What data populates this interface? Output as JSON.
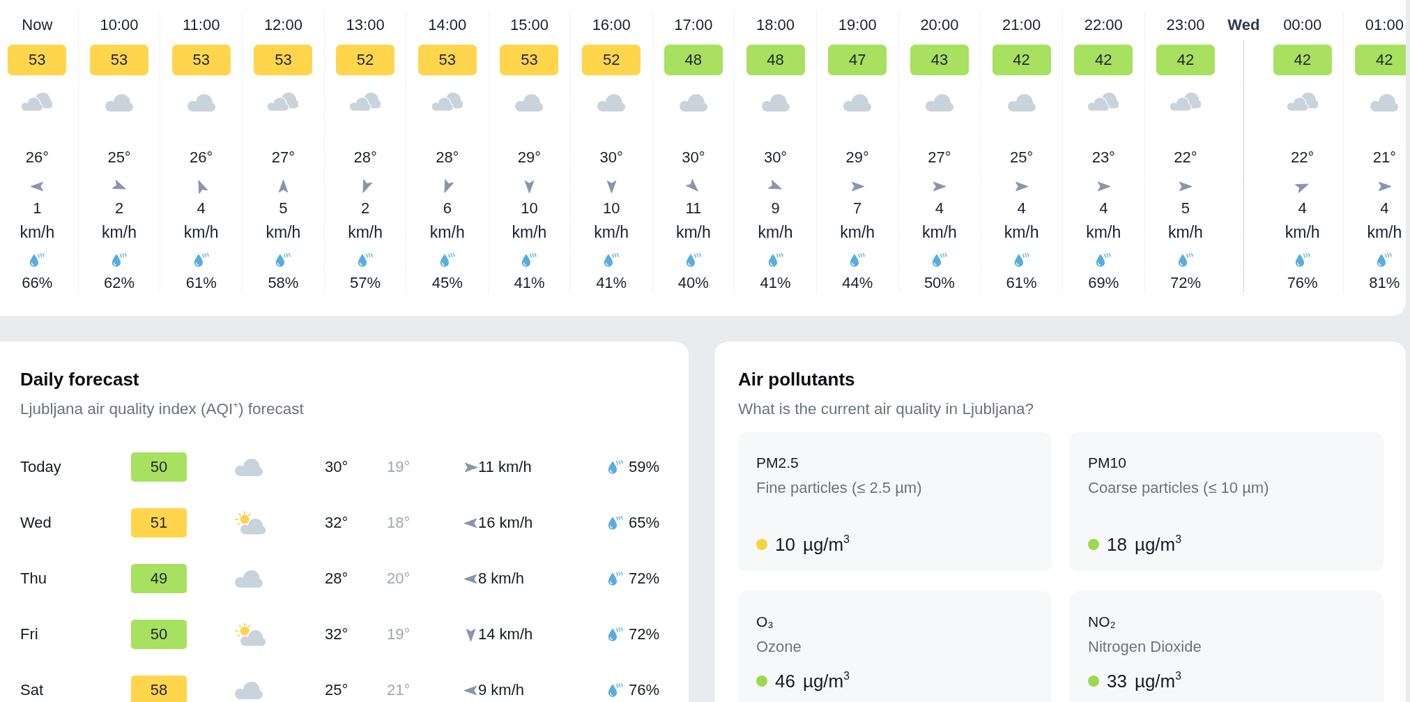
{
  "hourly": [
    {
      "kind": "hour",
      "time": "Now",
      "aqi": "53",
      "color": "#ffd54c",
      "icon": {
        "kind": "clouds"
      },
      "temperature": "26°",
      "arrow": {
        "kind": "w"
      },
      "wind": "1",
      "wind_unit": "km/h",
      "humidity": "66%"
    },
    {
      "kind": "hour",
      "time": "10:00",
      "aqi": "53",
      "color": "#ffd54c",
      "icon": {
        "kind": "cloud"
      },
      "temperature": "25°",
      "arrow": {
        "kind": "ese"
      },
      "wind": "2",
      "wind_unit": "km/h",
      "humidity": "62%"
    },
    {
      "kind": "hour",
      "time": "11:00",
      "aqi": "53",
      "color": "#ffd54c",
      "icon": {
        "kind": "cloud"
      },
      "temperature": "26°",
      "arrow": {
        "kind": "nnw"
      },
      "wind": "4",
      "wind_unit": "km/h",
      "humidity": "61%"
    },
    {
      "kind": "hour",
      "time": "12:00",
      "aqi": "53",
      "color": "#ffd54c",
      "icon": {
        "kind": "clouds"
      },
      "temperature": "27°",
      "arrow": {
        "kind": "n"
      },
      "wind": "5",
      "wind_unit": "km/h",
      "humidity": "58%"
    },
    {
      "kind": "hour",
      "time": "13:00",
      "aqi": "52",
      "color": "#ffd54c",
      "icon": {
        "kind": "clouds"
      },
      "temperature": "28°",
      "arrow": {
        "kind": "ssw"
      },
      "wind": "2",
      "wind_unit": "km/h",
      "humidity": "57%"
    },
    {
      "kind": "hour",
      "time": "14:00",
      "aqi": "53",
      "color": "#ffd54c",
      "icon": {
        "kind": "clouds"
      },
      "temperature": "28°",
      "arrow": {
        "kind": "ssw"
      },
      "wind": "6",
      "wind_unit": "km/h",
      "humidity": "45%"
    },
    {
      "kind": "hour",
      "time": "15:00",
      "aqi": "53",
      "color": "#ffd54c",
      "icon": {
        "kind": "cloud"
      },
      "temperature": "29°",
      "arrow": {
        "kind": "s"
      },
      "wind": "10",
      "wind_unit": "km/h",
      "humidity": "41%"
    },
    {
      "kind": "hour",
      "time": "16:00",
      "aqi": "52",
      "color": "#ffd54c",
      "icon": {
        "kind": "cloud"
      },
      "temperature": "30°",
      "arrow": {
        "kind": "s"
      },
      "wind": "10",
      "wind_unit": "km/h",
      "humidity": "41%"
    },
    {
      "kind": "hour",
      "time": "17:00",
      "aqi": "48",
      "color": "#a8e05f",
      "icon": {
        "kind": "cloud"
      },
      "temperature": "30°",
      "arrow": {
        "kind": "se"
      },
      "wind": "11",
      "wind_unit": "km/h",
      "humidity": "40%"
    },
    {
      "kind": "hour",
      "time": "18:00",
      "aqi": "48",
      "color": "#a8e05f",
      "icon": {
        "kind": "cloud"
      },
      "temperature": "30°",
      "arrow": {
        "kind": "ese"
      },
      "wind": "9",
      "wind_unit": "km/h",
      "humidity": "41%"
    },
    {
      "kind": "hour",
      "time": "19:00",
      "aqi": "47",
      "color": "#a8e05f",
      "icon": {
        "kind": "cloud"
      },
      "temperature": "29°",
      "arrow": {
        "kind": "e"
      },
      "wind": "7",
      "wind_unit": "km/h",
      "humidity": "44%"
    },
    {
      "kind": "hour",
      "time": "20:00",
      "aqi": "43",
      "color": "#a8e05f",
      "icon": {
        "kind": "cloud"
      },
      "temperature": "27°",
      "arrow": {
        "kind": "e"
      },
      "wind": "4",
      "wind_unit": "km/h",
      "humidity": "50%"
    },
    {
      "kind": "hour",
      "time": "21:00",
      "aqi": "42",
      "color": "#a8e05f",
      "icon": {
        "kind": "cloud"
      },
      "temperature": "25°",
      "arrow": {
        "kind": "e"
      },
      "wind": "4",
      "wind_unit": "km/h",
      "humidity": "61%"
    },
    {
      "kind": "hour",
      "time": "22:00",
      "aqi": "42",
      "color": "#a8e05f",
      "icon": {
        "kind": "clouds"
      },
      "temperature": "23°",
      "arrow": {
        "kind": "e"
      },
      "wind": "4",
      "wind_unit": "km/h",
      "humidity": "69%"
    },
    {
      "kind": "hour",
      "time": "23:00",
      "aqi": "42",
      "color": "#a8e05f",
      "icon": {
        "kind": "clouds"
      },
      "temperature": "22°",
      "arrow": {
        "kind": "e"
      },
      "wind": "5",
      "wind_unit": "km/h",
      "humidity": "72%"
    },
    {
      "kind": "day",
      "label": "Wed"
    },
    {
      "kind": "hour",
      "time": "00:00",
      "aqi": "42",
      "color": "#a8e05f",
      "icon": {
        "kind": "clouds"
      },
      "temperature": "22°",
      "arrow": {
        "kind": "ene"
      },
      "wind": "4",
      "wind_unit": "km/h",
      "humidity": "76%"
    },
    {
      "kind": "hour",
      "time": "01:00",
      "aqi": "42",
      "color": "#a8e05f",
      "icon": {
        "kind": "cloud"
      },
      "temperature": "21°",
      "arrow": {
        "kind": "e"
      },
      "wind": "4",
      "wind_unit": "km/h",
      "humidity": "81%"
    }
  ],
  "daily_forecast": {
    "title": "Daily forecast",
    "subtitle": "Ljubljana air quality index (AQI$^{+}$) forecast",
    "days": [
      {
        "day": "Today",
        "aqi": "50",
        "color": "#a8e05f",
        "icon": {
          "kind": "cloud"
        },
        "high": "30°",
        "low": "19°",
        "arrow": {
          "kind": "e"
        },
        "wind": "11 km/h",
        "humidity": "59%"
      },
      {
        "day": "Wed",
        "aqi": "51",
        "color": "#ffd54c",
        "icon": {
          "kind": "suncloud"
        },
        "high": "32°",
        "low": "18°",
        "arrow": {
          "kind": "w"
        },
        "wind": "16 km/h",
        "humidity": "65%"
      },
      {
        "day": "Thu",
        "aqi": "49",
        "color": "#a8e05f",
        "icon": {
          "kind": "cloud"
        },
        "high": "28°",
        "low": "20°",
        "arrow": {
          "kind": "w"
        },
        "wind": "8 km/h",
        "humidity": "72%"
      },
      {
        "day": "Fri",
        "aqi": "50",
        "color": "#a8e05f",
        "icon": {
          "kind": "suncloud"
        },
        "high": "32°",
        "low": "19°",
        "arrow": {
          "kind": "s"
        },
        "wind": "14 km/h",
        "humidity": "72%"
      },
      {
        "day": "Sat",
        "aqi": "58",
        "color": "#ffd54c",
        "icon": {
          "kind": "cloud"
        },
        "high": "25°",
        "low": "21°",
        "arrow": {
          "kind": "w"
        },
        "wind": "9 km/h",
        "humidity": "76%"
      }
    ]
  },
  "air_pollutants": {
    "title": "Air pollutants",
    "subtitle": "What is the current air quality in Ljubljana?",
    "items": [
      {
        "name": "PM2.5",
        "description": "Fine particles (≤ 2.5 µm)",
        "color": "#fbd13c",
        "value": "10",
        "unit": "µg/m$^{3}$"
      },
      {
        "name": "PM10",
        "description": "Coarse particles (≤ 10 µm)",
        "color": "#9ed84e",
        "value": "18",
        "unit": "µg/m$^{3}$"
      },
      {
        "name": "O₃",
        "description": "Ozone",
        "color": "#9ed84e",
        "value": "46",
        "unit": "µg/m$^{3}$"
      },
      {
        "name": "NO₂",
        "description": "Nitrogen Dioxide",
        "color": "#9ed84e",
        "value": "33",
        "unit": "µg/m$^{3}$"
      }
    ]
  }
}
